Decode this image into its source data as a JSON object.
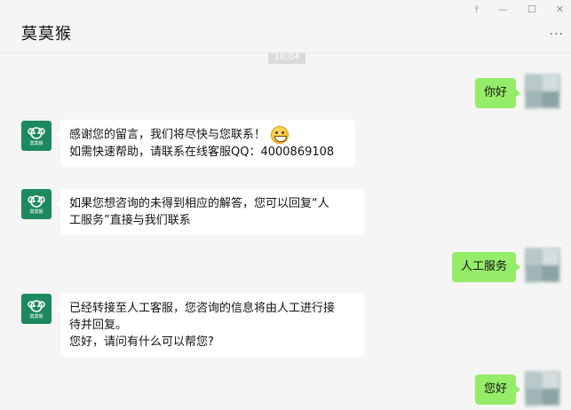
{
  "window": {
    "title": "莫莫猴",
    "controls": {
      "pin": "⫯",
      "minimize": "—",
      "maximize": "☐",
      "close": "✕"
    },
    "more": "···"
  },
  "chat": {
    "time": "10:04",
    "messages": [
      {
        "side": "right",
        "text": "你好"
      },
      {
        "side": "left",
        "lines": [
          "感谢您的留言，我们将尽快与您联系！",
          "如需快速帮助，请联系在线客服QQ：4000869108"
        ]
      },
      {
        "side": "left",
        "lines": [
          "如果您想咨询的未得到相应的解答，您可以回复“人",
          "工服务”直接与我们联系"
        ]
      },
      {
        "side": "right",
        "text": "人工服务"
      },
      {
        "side": "left",
        "lines": [
          "已经转接至人工客服，您咨询的信息将由人工进行接",
          "待并回复。",
          "您好，请问有什么可以帮您?"
        ]
      },
      {
        "side": "right",
        "text": "您好"
      }
    ]
  },
  "bot_avatar": {
    "logo_text": "莫莫猴"
  },
  "colors": {
    "bubble_green": "#95ec69",
    "bubble_white": "#ffffff",
    "bot_avatar": "#1c8a5e",
    "background": "#f5f5f5"
  }
}
